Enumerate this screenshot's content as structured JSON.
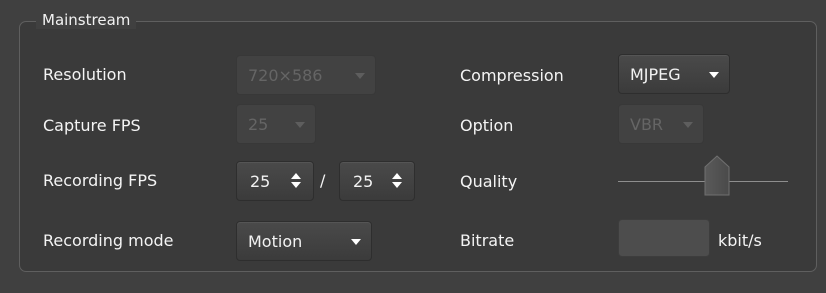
{
  "group": {
    "title": "Mainstream"
  },
  "resolution": {
    "label": "Resolution",
    "value": "720×586"
  },
  "capture_fps": {
    "label": "Capture FPS",
    "value": "25"
  },
  "recording_fps": {
    "label": "Recording FPS",
    "value_a": "25",
    "separator": "/",
    "value_b": "25"
  },
  "recording_mode": {
    "label": "Recording mode",
    "value": "Motion"
  },
  "compression": {
    "label": "Compression",
    "value": "MJPEG"
  },
  "option": {
    "label": "Option",
    "value": "VBR"
  },
  "quality": {
    "label": "Quality",
    "level_fraction": 0.58
  },
  "bitrate": {
    "label": "Bitrate",
    "value": "",
    "unit": "kbit/s"
  }
}
